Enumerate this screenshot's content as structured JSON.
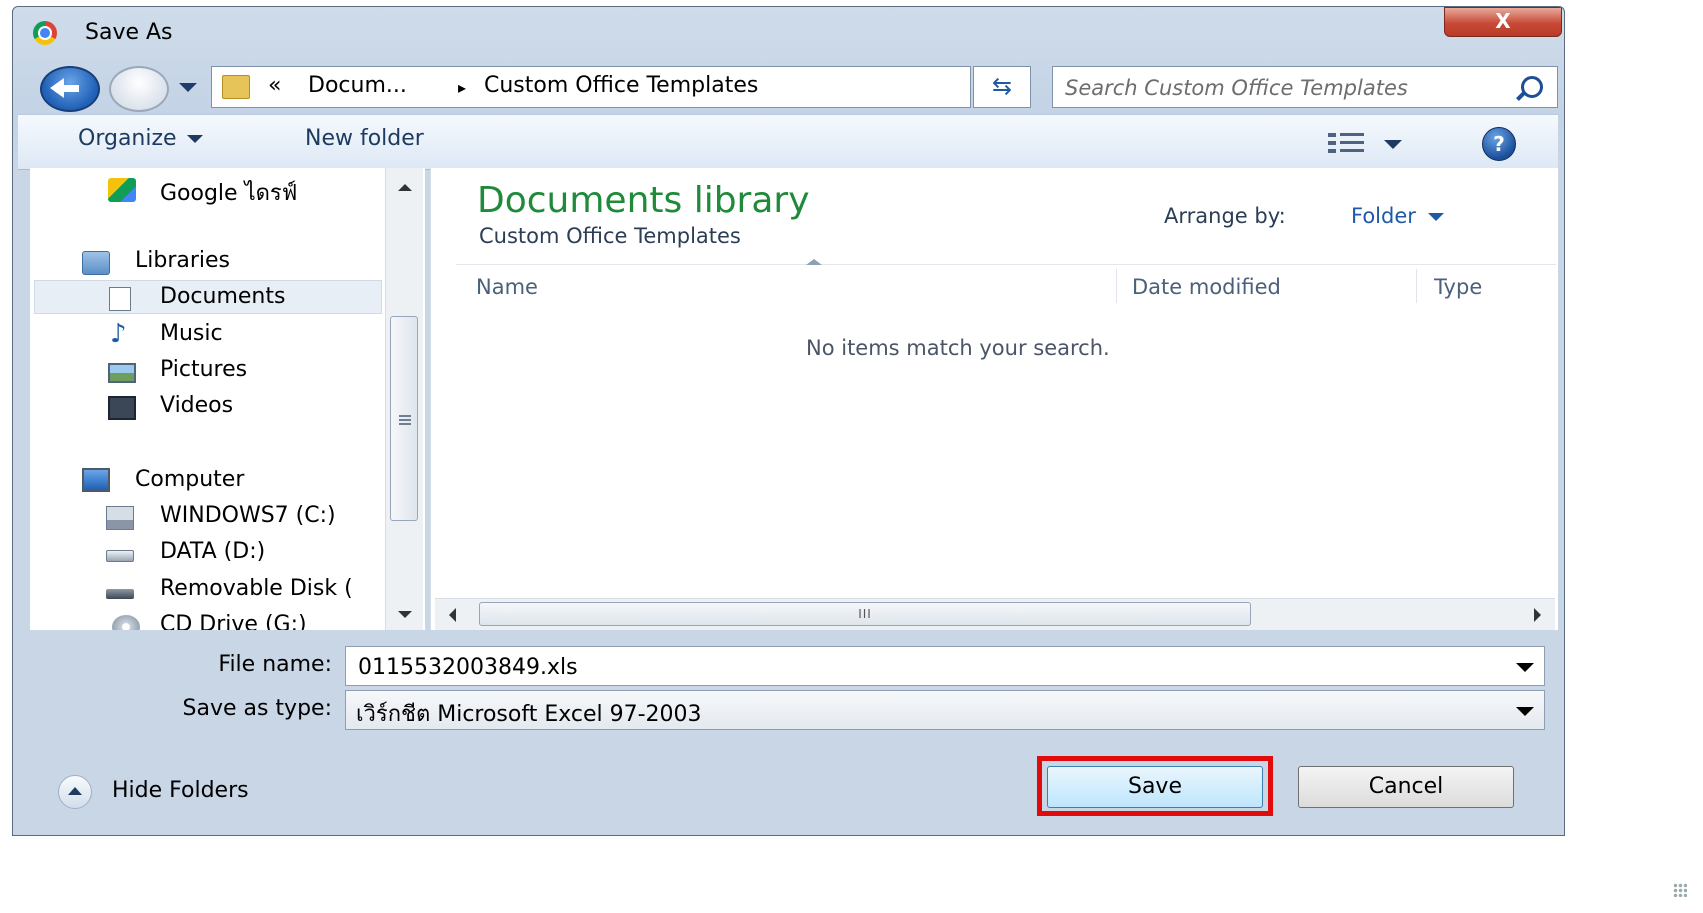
{
  "window": {
    "title": "Save As",
    "close_symbol": "X"
  },
  "address": {
    "overflow": "«",
    "crumbs": [
      "Docum...",
      "Custom Office Templates"
    ],
    "separator": "▸"
  },
  "search": {
    "placeholder": "Search Custom Office Templates"
  },
  "toolbar": {
    "organize": "Organize",
    "new_folder": "New folder",
    "help": "?"
  },
  "nav": {
    "google_drive": "Google ไดรฟ์",
    "libraries": "Libraries",
    "documents": "Documents",
    "music": "Music",
    "pictures": "Pictures",
    "videos": "Videos",
    "computer": "Computer",
    "c_drive": "WINDOWS7 (C:)",
    "d_drive": "DATA (D:)",
    "removable": "Removable Disk (",
    "cd_drive": "CD Drive (G:)"
  },
  "content": {
    "library_title": "Documents library",
    "library_subtitle": "Custom Office Templates",
    "arrange_label": "Arrange by:",
    "arrange_value": "Folder",
    "columns": {
      "name": "Name",
      "date": "Date modified",
      "type": "Type"
    },
    "empty_message": "No items match your search.",
    "hscroll_grip": "III"
  },
  "form": {
    "file_name_label": "File name:",
    "file_name_value": "0115532003849.xls",
    "save_type_label": "Save as type:",
    "save_type_value": "เวิร์กชีต Microsoft Excel 97-2003"
  },
  "footer": {
    "hide_folders": "Hide Folders",
    "save": "Save",
    "cancel": "Cancel"
  },
  "colors": {
    "library_title": "#1e8a3a",
    "highlight": "#e20b0b",
    "link": "#1e5aa8"
  }
}
